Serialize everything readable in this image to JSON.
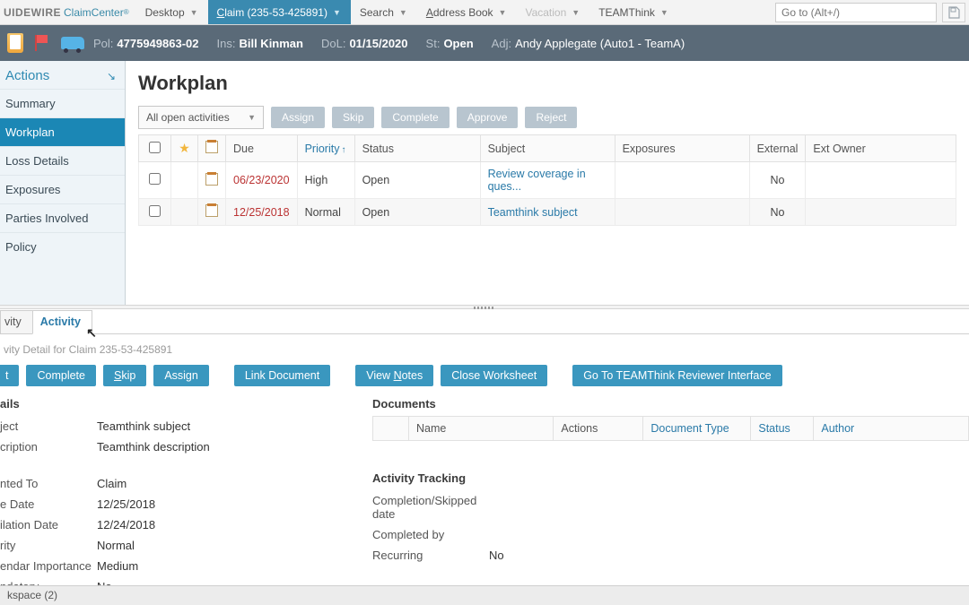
{
  "brand": {
    "part1": "UIDEWIRE",
    "part2": "ClaimCenter"
  },
  "menu": {
    "desktop": "Desktop",
    "claim_prefix": "C",
    "claim_rest": "laim (235-53-425891)",
    "search": "Search",
    "address_prefix": "A",
    "address_rest": "ddress Book",
    "vacation": "Vacation",
    "teamthink": "TEAMThink",
    "goto_placeholder": "Go to (Alt+/)"
  },
  "claimbar": {
    "pol_label": "Pol:",
    "pol_value": "4775949863-02",
    "ins_label": "Ins:",
    "ins_value": "Bill Kinman",
    "dol_label": "DoL:",
    "dol_value": "01/15/2020",
    "st_label": "St:",
    "st_value": "Open",
    "adj_label": "Adj:",
    "adj_value": "Andy Applegate (Auto1 - TeamA)"
  },
  "sidebar": {
    "actions_hdr": "Actions",
    "items": [
      "Summary",
      "Workplan",
      "Loss Details",
      "Exposures",
      "Parties Involved",
      "Policy"
    ]
  },
  "content": {
    "title": "Workplan",
    "filter": "All open activities",
    "buttons": {
      "assign": "Assign",
      "skip": "Skip",
      "complete": "Complete",
      "approve": "Approve",
      "reject": "Reject"
    },
    "columns": {
      "due": "Due",
      "priority": "Priority",
      "status": "Status",
      "subject": "Subject",
      "exposures": "Exposures",
      "external": "External",
      "extowner": "Ext Owner"
    },
    "rows": [
      {
        "due": "06/23/2020",
        "priority": "High",
        "status": "Open",
        "subject": "Review coverage in ques...",
        "external": "No"
      },
      {
        "due": "12/25/2018",
        "priority": "Normal",
        "status": "Open",
        "subject": "Teamthink subject",
        "external": "No"
      }
    ]
  },
  "tabs": {
    "partial": "vity",
    "activity": "Activity"
  },
  "detail": {
    "title": "vity Detail for Claim 235-53-425891",
    "buttons": {
      "partial": "t",
      "complete": "Complete",
      "skip_s": "S",
      "skip_rest": "kip",
      "assign": "Assign",
      "linkdoc": "Link Document",
      "viewnotes_pre": "View ",
      "viewnotes_u": "N",
      "viewnotes_post": "otes",
      "closews": "Close Worksheet",
      "goto": "Go To TEAMThink Reviewer Interface"
    },
    "left": {
      "section": "ails",
      "labels": {
        "subject": "ject",
        "description": "cription",
        "relatedto": "nted To",
        "duedate": "e Date",
        "escdate": "ilation Date",
        "priority": "rity",
        "calimp": "endar Importance",
        "mandatory": "ndatory"
      },
      "values": {
        "subject": "Teamthink subject",
        "description": "Teamthink description",
        "relatedto": "Claim",
        "duedate": "12/25/2018",
        "escdate": "12/24/2018",
        "priority": "Normal",
        "calimp": "Medium",
        "mandatory": "No"
      }
    },
    "right": {
      "docs_title": "Documents",
      "doccols": {
        "name": "Name",
        "actions": "Actions",
        "doctype": "Document Type",
        "status": "Status",
        "author": "Author"
      },
      "tracking_title": "Activity Tracking",
      "track": {
        "compdate_label": "Completion/Skipped date",
        "compdate_value": "",
        "compby_label": "Completed by",
        "compby_value": "",
        "recurring_label": "Recurring",
        "recurring_value": "No"
      }
    }
  },
  "workspace": {
    "label": "kspace (2)"
  }
}
